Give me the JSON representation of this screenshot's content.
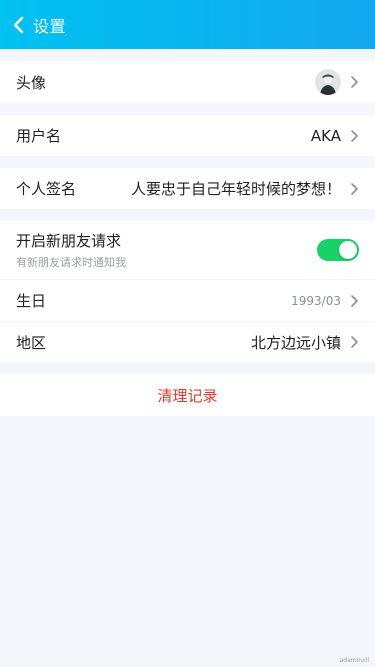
{
  "header": {
    "title": "设置",
    "back_icon": "chevron-left-icon"
  },
  "profile": {
    "avatar_label": "头像",
    "username_label": "用户名",
    "username_value": "AKA"
  },
  "signature": {
    "label": "个人签名",
    "value": "人要忠于自己年轻时候的梦想！"
  },
  "settings": {
    "friend_request_label": "开启新朋友请求",
    "friend_request_sub": "有新朋友请求时通知我",
    "friend_request_enabled": true,
    "birthday_label": "生日",
    "birthday_value": "1993/03",
    "region_label": "地区",
    "region_value": "北方边远小镇"
  },
  "actions": {
    "clear_label": "清理记录"
  },
  "colors": {
    "header_start": "#00c2f1",
    "header_end": "#13a7ef",
    "toggle_on": "#18d168",
    "danger": "#e23a2f",
    "background": "#f3f6fa"
  },
  "watermark": "adaminxll"
}
